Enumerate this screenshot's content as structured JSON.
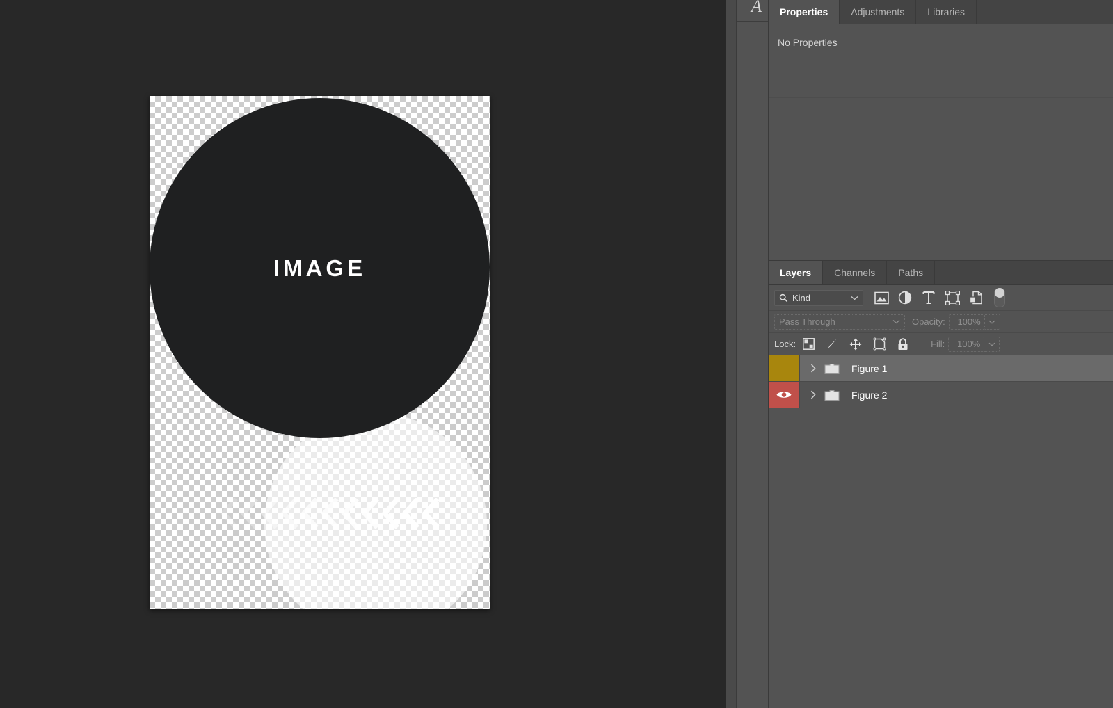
{
  "canvas": {
    "artwork_label": "IMAGE",
    "chevron_count": 11,
    "chevron_icon": "chevron-left-icon"
  },
  "icon_dock": {
    "items": [
      {
        "name": "character-panel-icon",
        "glyph": "A"
      }
    ]
  },
  "properties_panel": {
    "tabs": [
      {
        "label": "Properties",
        "active": true
      },
      {
        "label": "Adjustments",
        "active": false
      },
      {
        "label": "Libraries",
        "active": false
      }
    ],
    "empty_message": "No Properties"
  },
  "layers_panel": {
    "tabs": [
      {
        "label": "Layers",
        "active": true
      },
      {
        "label": "Channels",
        "active": false
      },
      {
        "label": "Paths",
        "active": false
      }
    ],
    "filter": {
      "search_icon": "search-icon",
      "kind_label": "Kind",
      "dropdown_icon": "chevron-down-icon",
      "type_filters": [
        {
          "name": "filter-pixel-layers-icon"
        },
        {
          "name": "filter-adjustment-layers-icon"
        },
        {
          "name": "filter-type-layers-icon",
          "glyph": "T"
        },
        {
          "name": "filter-shape-layers-icon"
        },
        {
          "name": "filter-smart-object-layers-icon"
        }
      ],
      "toggle_name": "filter-enable-toggle"
    },
    "blend": {
      "mode": "Pass Through",
      "opacity_label": "Opacity:",
      "opacity_value": "100%"
    },
    "lock": {
      "label": "Lock:",
      "icons": [
        {
          "name": "lock-transparent-pixels-icon"
        },
        {
          "name": "lock-image-pixels-icon"
        },
        {
          "name": "lock-position-icon"
        },
        {
          "name": "lock-nesting-icon"
        },
        {
          "name": "lock-all-icon"
        }
      ],
      "fill_label": "Fill:",
      "fill_value": "100%"
    },
    "layers": [
      {
        "name": "Figure 1",
        "selected": true,
        "visible": false,
        "swatch_color": "#a8860d",
        "expanded": false,
        "icon": "folder-icon"
      },
      {
        "name": "Figure 2",
        "selected": false,
        "visible": true,
        "swatch_color": "#c0504a",
        "expanded": false,
        "icon": "folder-icon"
      }
    ]
  },
  "colors": {
    "app_background": "#282828",
    "panel_background": "#535353",
    "tab_inactive": "#444444",
    "selected_row": "#6a6a6a",
    "artwork_dark": "#1f2021"
  }
}
